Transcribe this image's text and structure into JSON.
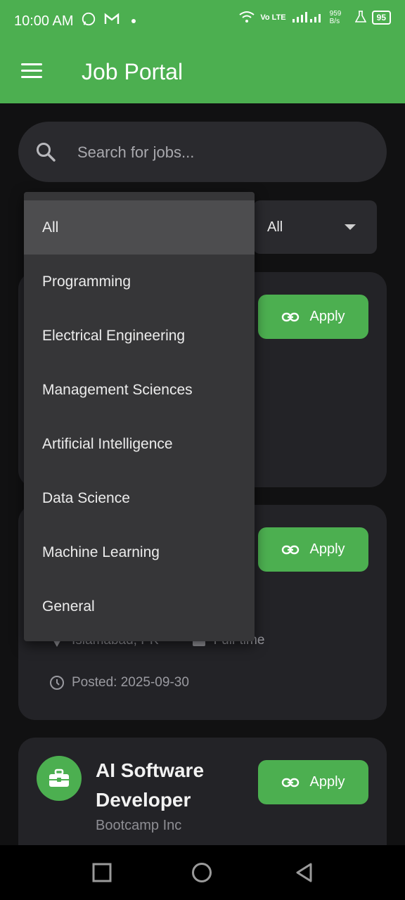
{
  "status_bar": {
    "time": "10:00 AM",
    "network": "Vo LTE",
    "speed": "959 B/s",
    "battery": "95"
  },
  "app_bar": {
    "title": "Job Portal"
  },
  "search": {
    "placeholder": "Search for jobs..."
  },
  "filters": {
    "second_value": "All"
  },
  "category_menu": {
    "selected": "All",
    "items": [
      "All",
      "Programming",
      "Electrical Engineering",
      "Management Sciences",
      "Artificial Intelligence",
      "Data Science",
      "Machine Learning",
      "General"
    ]
  },
  "jobs": [
    {
      "apply_label": "Apply"
    },
    {
      "apply_label": "Apply",
      "location": "Islamabad, PK",
      "type": "Full-time",
      "posted": "Posted: 2025-09-30"
    },
    {
      "apply_label": "Apply",
      "title": "AI Software Developer",
      "company": "Bootcamp Inc"
    }
  ],
  "colors": {
    "accent": "#4caf50",
    "background": "#111112",
    "card": "#232327",
    "menu": "#363638"
  }
}
